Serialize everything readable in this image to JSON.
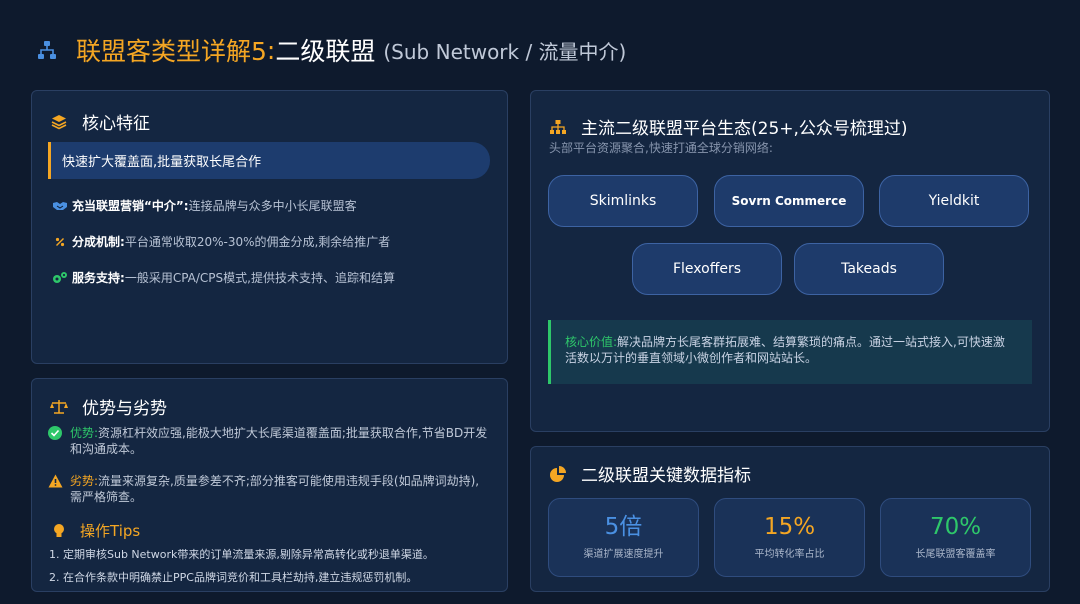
{
  "header": {
    "title_main": "联盟客类型详解5",
    "title_colon": ":",
    "title_strong": "二级联盟",
    "title_sub": "(Sub Network / 流量中介)",
    "icon": "sitemap-icon"
  },
  "core_features": {
    "title": "核心特征",
    "icon": "layers-icon",
    "highlight": "快速扩大覆盖面,批量获取长尾合作",
    "items": [
      {
        "icon": "handshake-icon",
        "label": "充当联盟营销“中介”:",
        "text": "连接品牌与众多中小长尾联盟客"
      },
      {
        "icon": "percent-icon",
        "label": "分成机制:",
        "text": "平台通常收取20%-30%的佣金分成,剩余给推广者"
      },
      {
        "icon": "gears-icon",
        "label": "服务支持:",
        "text": "一般采用CPA/CPS模式,提供技术支持、追踪和结算"
      }
    ]
  },
  "pros_cons": {
    "title": "优势与劣势",
    "icon": "scale-icon",
    "pro_label": "优势:",
    "pro_text": "资源杠杆效应强,能极大地扩大长尾渠道覆盖面;批量获取合作,节省BD开发和沟通成本。",
    "con_label": "劣势:",
    "con_text": "流量来源复杂,质量参差不齐;部分推客可能使用违规手段(如品牌词劫持),需严格筛查。",
    "tips_title": "操作Tips",
    "tips": [
      "1. 定期审核Sub Network带来的订单流量来源,剔除异常高转化或秒退单渠道。",
      "2. 在合作条款中明确禁止PPC品牌词竞价和工具栏劫持,建立违规惩罚机制。"
    ]
  },
  "ecosystem": {
    "title": "主流二级联盟平台生态(25+,公众号梳理过)",
    "icon": "network-icon",
    "subtitle": "头部平台资源聚合,快速打通全球分销网络:",
    "platforms": [
      "Skimlinks",
      "Sovrn Commerce",
      "Yieldkit",
      "Flexoffers",
      "Takeads"
    ],
    "core_label": "核心价值:",
    "core_text": "解决品牌方长尾客群拓展难、结算繁琐的痛点。通过一站式接入,可快速激活数以万计的垂直领域小微创作者和网站站长。"
  },
  "metrics": {
    "title": "二级联盟关键数据指标",
    "icon": "pie-chart-icon",
    "items": [
      {
        "value": "5倍",
        "label": "渠道扩展速度提升",
        "color": "#4a90e2"
      },
      {
        "value": "15%",
        "label": "平均转化率占比",
        "color": "#f4a623"
      },
      {
        "value": "70%",
        "label": "长尾联盟客覆盖率",
        "color": "#2ec76a"
      }
    ]
  }
}
